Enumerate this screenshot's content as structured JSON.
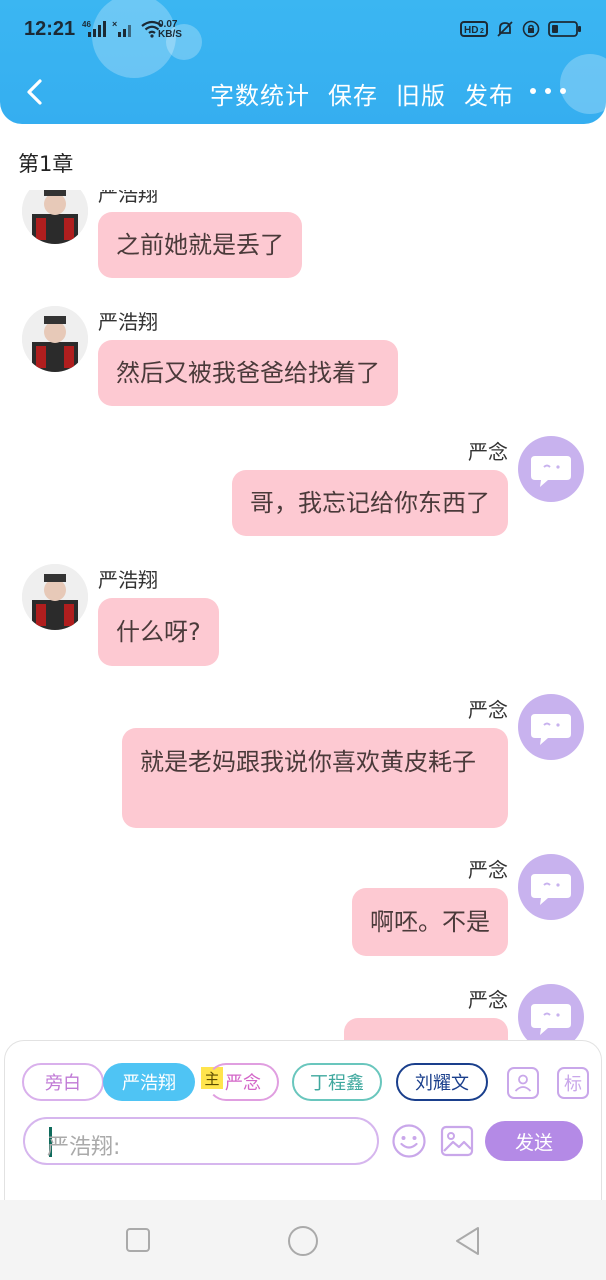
{
  "status": {
    "time": "12:21",
    "network": "46",
    "speed_value": "0.07",
    "speed_unit": "KB/S",
    "hd_label": "HD",
    "hd_sub": "2"
  },
  "nav": {
    "actions": [
      "字数统计",
      "保存",
      "旧版",
      "发布"
    ]
  },
  "chapter_title": "第1章",
  "messages": [
    {
      "side": "left",
      "name": "严浩翔",
      "text": "之前她就是丢了"
    },
    {
      "side": "left",
      "name": "严浩翔",
      "text": "然后又被我爸爸给找着了"
    },
    {
      "side": "right",
      "name": "严念",
      "text": "哥，我忘记给你东西了"
    },
    {
      "side": "left",
      "name": "严浩翔",
      "text": "什么呀?"
    },
    {
      "side": "right",
      "name": "严念",
      "text": "就是老妈跟我说你喜欢黄皮耗子"
    },
    {
      "side": "right",
      "name": "严念",
      "text": "啊呸。不是"
    },
    {
      "side": "right",
      "name": "严念",
      "text": ""
    }
  ],
  "composer": {
    "chips": [
      "旁白",
      "严浩翔",
      "严念",
      "丁程鑫",
      "刘耀文"
    ],
    "main_badge": "主",
    "tag_icon_label": "标",
    "input_placeholder": "严浩翔:",
    "send_label": "发送"
  },
  "colors": {
    "header": "#35aef0",
    "bubble": "#fdc9d2",
    "accent_purple": "#b48ae6"
  }
}
